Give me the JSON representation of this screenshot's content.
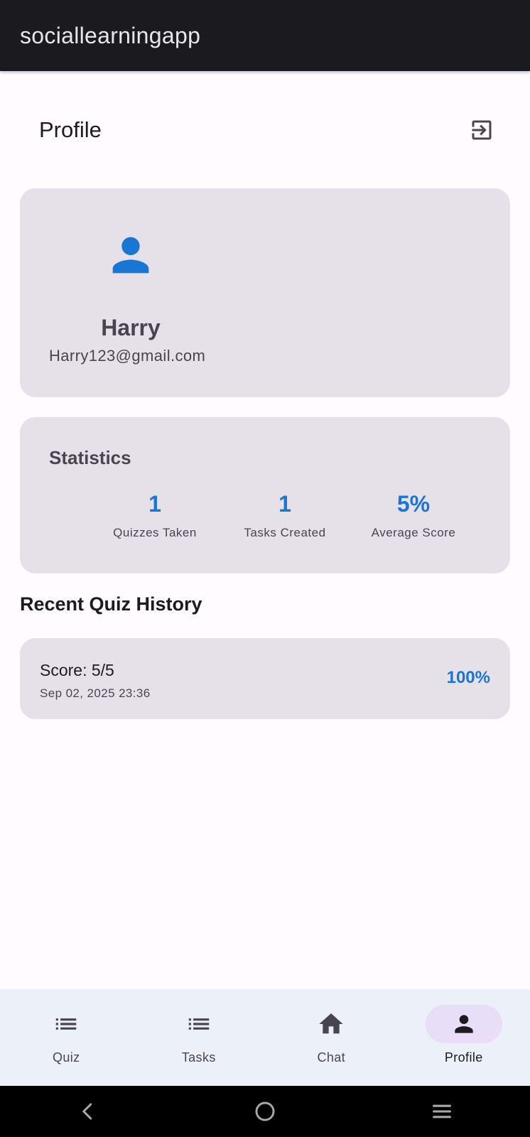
{
  "app": {
    "title": "sociallearningapp"
  },
  "profile_header": {
    "title": "Profile",
    "logout_icon": "logout-icon"
  },
  "user": {
    "name": "Harry",
    "email": "Harry123@gmail.com",
    "avatar_icon": "person-icon"
  },
  "statistics": {
    "title": "Statistics",
    "items": [
      {
        "value": "1",
        "label": "Quizzes Taken"
      },
      {
        "value": "1",
        "label": "Tasks Created"
      },
      {
        "value": "5%",
        "label": "Average Score"
      }
    ]
  },
  "history": {
    "title": "Recent Quiz History",
    "items": [
      {
        "score": "Score: 5/5",
        "date": "Sep 02, 2025 23:36",
        "percent": "100%"
      }
    ]
  },
  "bottom_nav": {
    "items": [
      {
        "label": "Quiz",
        "icon": "list-icon",
        "active": false
      },
      {
        "label": "Tasks",
        "icon": "list-icon",
        "active": false
      },
      {
        "label": "Chat",
        "icon": "home-icon",
        "active": false
      },
      {
        "label": "Profile",
        "icon": "person-icon",
        "active": true
      }
    ]
  },
  "system_nav": {
    "items": [
      "back-icon",
      "home-circle-icon",
      "menu-icon"
    ]
  },
  "colors": {
    "accent": "#1976d2",
    "card": "#e6e0e9",
    "nav_active": "#e8def8",
    "appbar": "#1b1b1f"
  }
}
